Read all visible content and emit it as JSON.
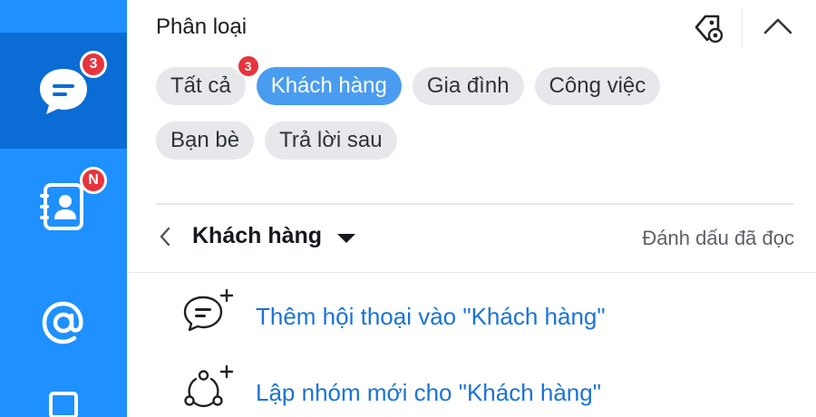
{
  "rail": {
    "messages_badge": "3",
    "contacts_badge": "N"
  },
  "header": {
    "title": "Phân loại"
  },
  "chips": {
    "row1": [
      {
        "label": "Tất cả",
        "badge": "3"
      },
      {
        "label": "Khách hàng",
        "active": true
      },
      {
        "label": "Gia đình"
      },
      {
        "label": "Công việc"
      }
    ],
    "row2": [
      {
        "label": "Bạn bè"
      },
      {
        "label": "Trả lời sau"
      }
    ]
  },
  "filter": {
    "name": "Khách hàng",
    "mark_read": "Đánh dấu đã đọc"
  },
  "actions": [
    {
      "label": "Thêm hội thoại vào \"Khách hàng\"",
      "icon": "chat-plus-icon"
    },
    {
      "label": "Lập nhóm mới cho \"Khách hàng\"",
      "icon": "group-plus-icon"
    }
  ],
  "colors": {
    "rail": "#1e90ff",
    "rail_active": "#0a6cd4",
    "badge": "#e8343c",
    "chip_active": "#4a9cf0",
    "link": "#1a73d9"
  }
}
